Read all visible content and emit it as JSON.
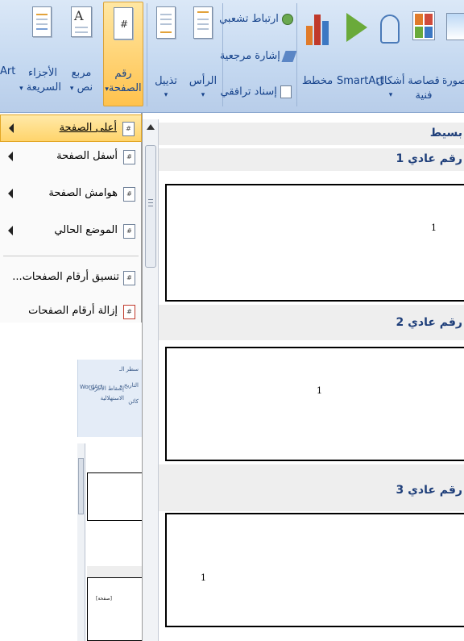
{
  "ribbon": {
    "art_label": "Art",
    "quick_parts": {
      "line1": "الأجزاء",
      "line2": "السريعة"
    },
    "text_box": {
      "line1": "مربع",
      "line2": "نص"
    },
    "page_number": {
      "line1": "رقم",
      "line2": "الصفحة"
    },
    "footer_label": "تذييل",
    "header_label": "الرأس",
    "hyperlink_label": "ارتباط تشعبي",
    "bookmark_label": "إشارة مرجعية",
    "cross_ref_label": "إسناد ترافقي",
    "chart_label": "مخطط",
    "smartart_label": "SmartArt",
    "shapes_label": "أشكال",
    "clipart": {
      "line1": "قصاصة",
      "line2": "فنية"
    },
    "picture_label": "صورة",
    "page_number_icon_glyph": "#"
  },
  "menu": {
    "items": [
      {
        "label": "أعلى الصفحة",
        "icon_glyph": "#",
        "has_submenu": true,
        "active": true
      },
      {
        "label": "أسفل الصفحة",
        "icon_glyph": "#",
        "has_submenu": true,
        "active": false
      },
      {
        "label": "هوامش الصفحة",
        "icon_glyph": "#",
        "has_submenu": true,
        "active": false
      },
      {
        "label": "الموضع الحالي",
        "icon_glyph": "#",
        "has_submenu": true,
        "active": false
      },
      {
        "label": "تنسيق أرقام الصفحات...",
        "icon_glyph": "#",
        "has_submenu": false,
        "active": false
      },
      {
        "label": "إزالة أرقام الصفحات",
        "icon_glyph": "#",
        "has_submenu": false,
        "active": false
      }
    ]
  },
  "gallery": {
    "section_header": "بسيط",
    "items": [
      {
        "label": "رقم عادي 1",
        "page_number": "1"
      },
      {
        "label": "رقم عادي 2",
        "page_number": "1"
      },
      {
        "label": "رقم عادي 3",
        "page_number": "1"
      }
    ]
  },
  "background_doc": {
    "mini_labels": [
      "سطر الـ",
      "التاريخ و",
      "كائن",
      "إسقاط الأحرف",
      "الاستهلالية",
      "WordArt"
    ],
    "mini_page_text": "[صفحة]"
  },
  "colors": {
    "ribbon_text": "#15428b",
    "menu_highlight": "#ffd46b",
    "category_text": "#1f3f7a"
  }
}
